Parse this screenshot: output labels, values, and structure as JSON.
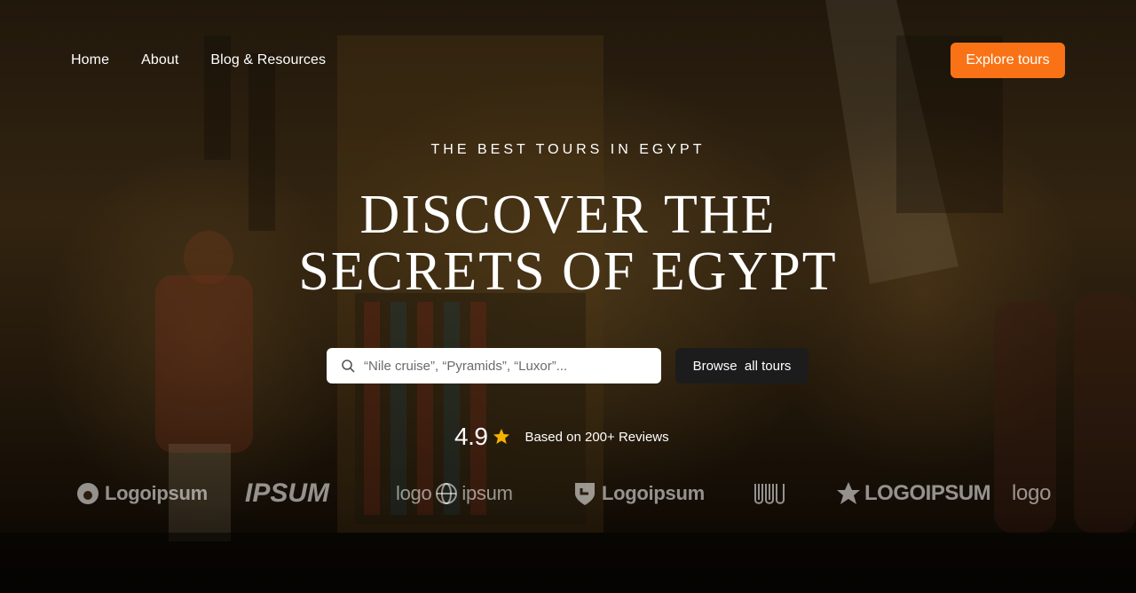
{
  "nav": {
    "links": [
      "Home",
      "About",
      "Blog & Resources"
    ],
    "cta_label": "Explore tours"
  },
  "hero": {
    "eyebrow": "THE BEST TOURS IN EGYPT",
    "headline_line1": "DISCOVER THE",
    "headline_line2": "SECRETS OF EGYPT"
  },
  "search": {
    "placeholder": "“Nile cruise”, “Pyramids”, “Luxor”...",
    "icon": "search-icon",
    "button_label": "Browse  all tours"
  },
  "rating": {
    "value": "4.9",
    "icon": "star-icon",
    "text": "Based on 200+ Reviews"
  },
  "logos": [
    "Logoipsum",
    "IPSUM",
    "logo",
    "ipsum",
    "Logoipsum",
    "LOGOIPSUM",
    "logo"
  ],
  "colors": {
    "accent": "#f97316",
    "dark_button": "#1c1c1c",
    "star": "#f5b301"
  }
}
